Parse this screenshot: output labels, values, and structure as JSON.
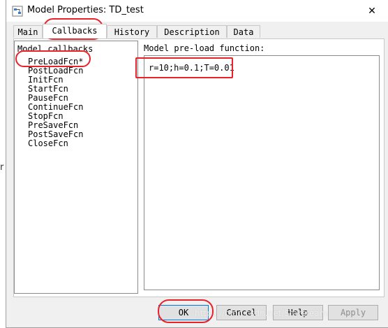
{
  "window": {
    "title": "Model Properties: TD_test",
    "close_glyph": "✕"
  },
  "behind": {
    "glyph": "r"
  },
  "tabs": [
    {
      "label": "Main"
    },
    {
      "label": "Callbacks"
    },
    {
      "label": "History"
    },
    {
      "label": "Description"
    },
    {
      "label": "Data"
    }
  ],
  "active_tab": "Callbacks",
  "callbacks": {
    "header": "Model callbacks",
    "items": [
      {
        "label": "PreLoadFcn*"
      },
      {
        "label": "PostLoadFcn"
      },
      {
        "label": "InitFcn"
      },
      {
        "label": "StartFcn"
      },
      {
        "label": "PauseFcn"
      },
      {
        "label": "ContinueFcn"
      },
      {
        "label": "StopFcn"
      },
      {
        "label": "PreSaveFcn"
      },
      {
        "label": "PostSaveFcn"
      },
      {
        "label": "CloseFcn"
      }
    ]
  },
  "editor": {
    "label": "Model pre-load function:",
    "content": "r=10;h=0.1;T=0.01"
  },
  "buttons": {
    "ok": "OK",
    "cancel": "Cancel",
    "help": "Help",
    "apply": "Apply"
  },
  "watermark": "https://blog.csdn.net/Starsream",
  "colors": {
    "highlight": "#e8212b",
    "ok_border": "#0078d7",
    "app_icon": "#3a7bd5"
  }
}
